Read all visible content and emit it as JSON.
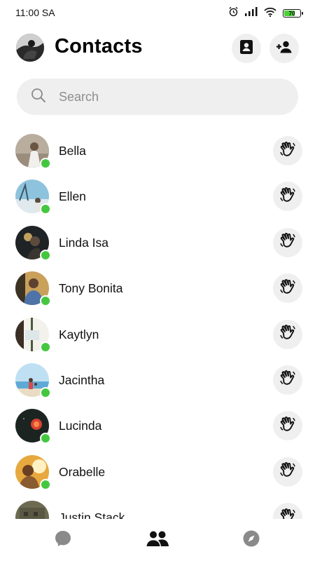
{
  "status_bar": {
    "time": "11:00 SA",
    "battery": "70"
  },
  "header": {
    "title": "Contacts"
  },
  "search": {
    "placeholder": "Search"
  },
  "contacts": [
    {
      "name": "Bella",
      "online": true
    },
    {
      "name": "Ellen",
      "online": true
    },
    {
      "name": "Linda Isa",
      "online": true
    },
    {
      "name": "Tony Bonita",
      "online": true
    },
    {
      "name": "Kaytlyn",
      "online": true
    },
    {
      "name": "Jacintha",
      "online": true
    },
    {
      "name": "Lucinda",
      "online": true
    },
    {
      "name": "Orabelle",
      "online": true
    },
    {
      "name": "Justin Stack",
      "online": false
    }
  ],
  "bottom_nav": {
    "items": [
      "chat-icon",
      "people-icon",
      "discover-icon"
    ],
    "active": "people-icon"
  },
  "colors": {
    "online": "#44c73f",
    "button_bg": "#efefef",
    "battery_fill": "#4cd137"
  }
}
